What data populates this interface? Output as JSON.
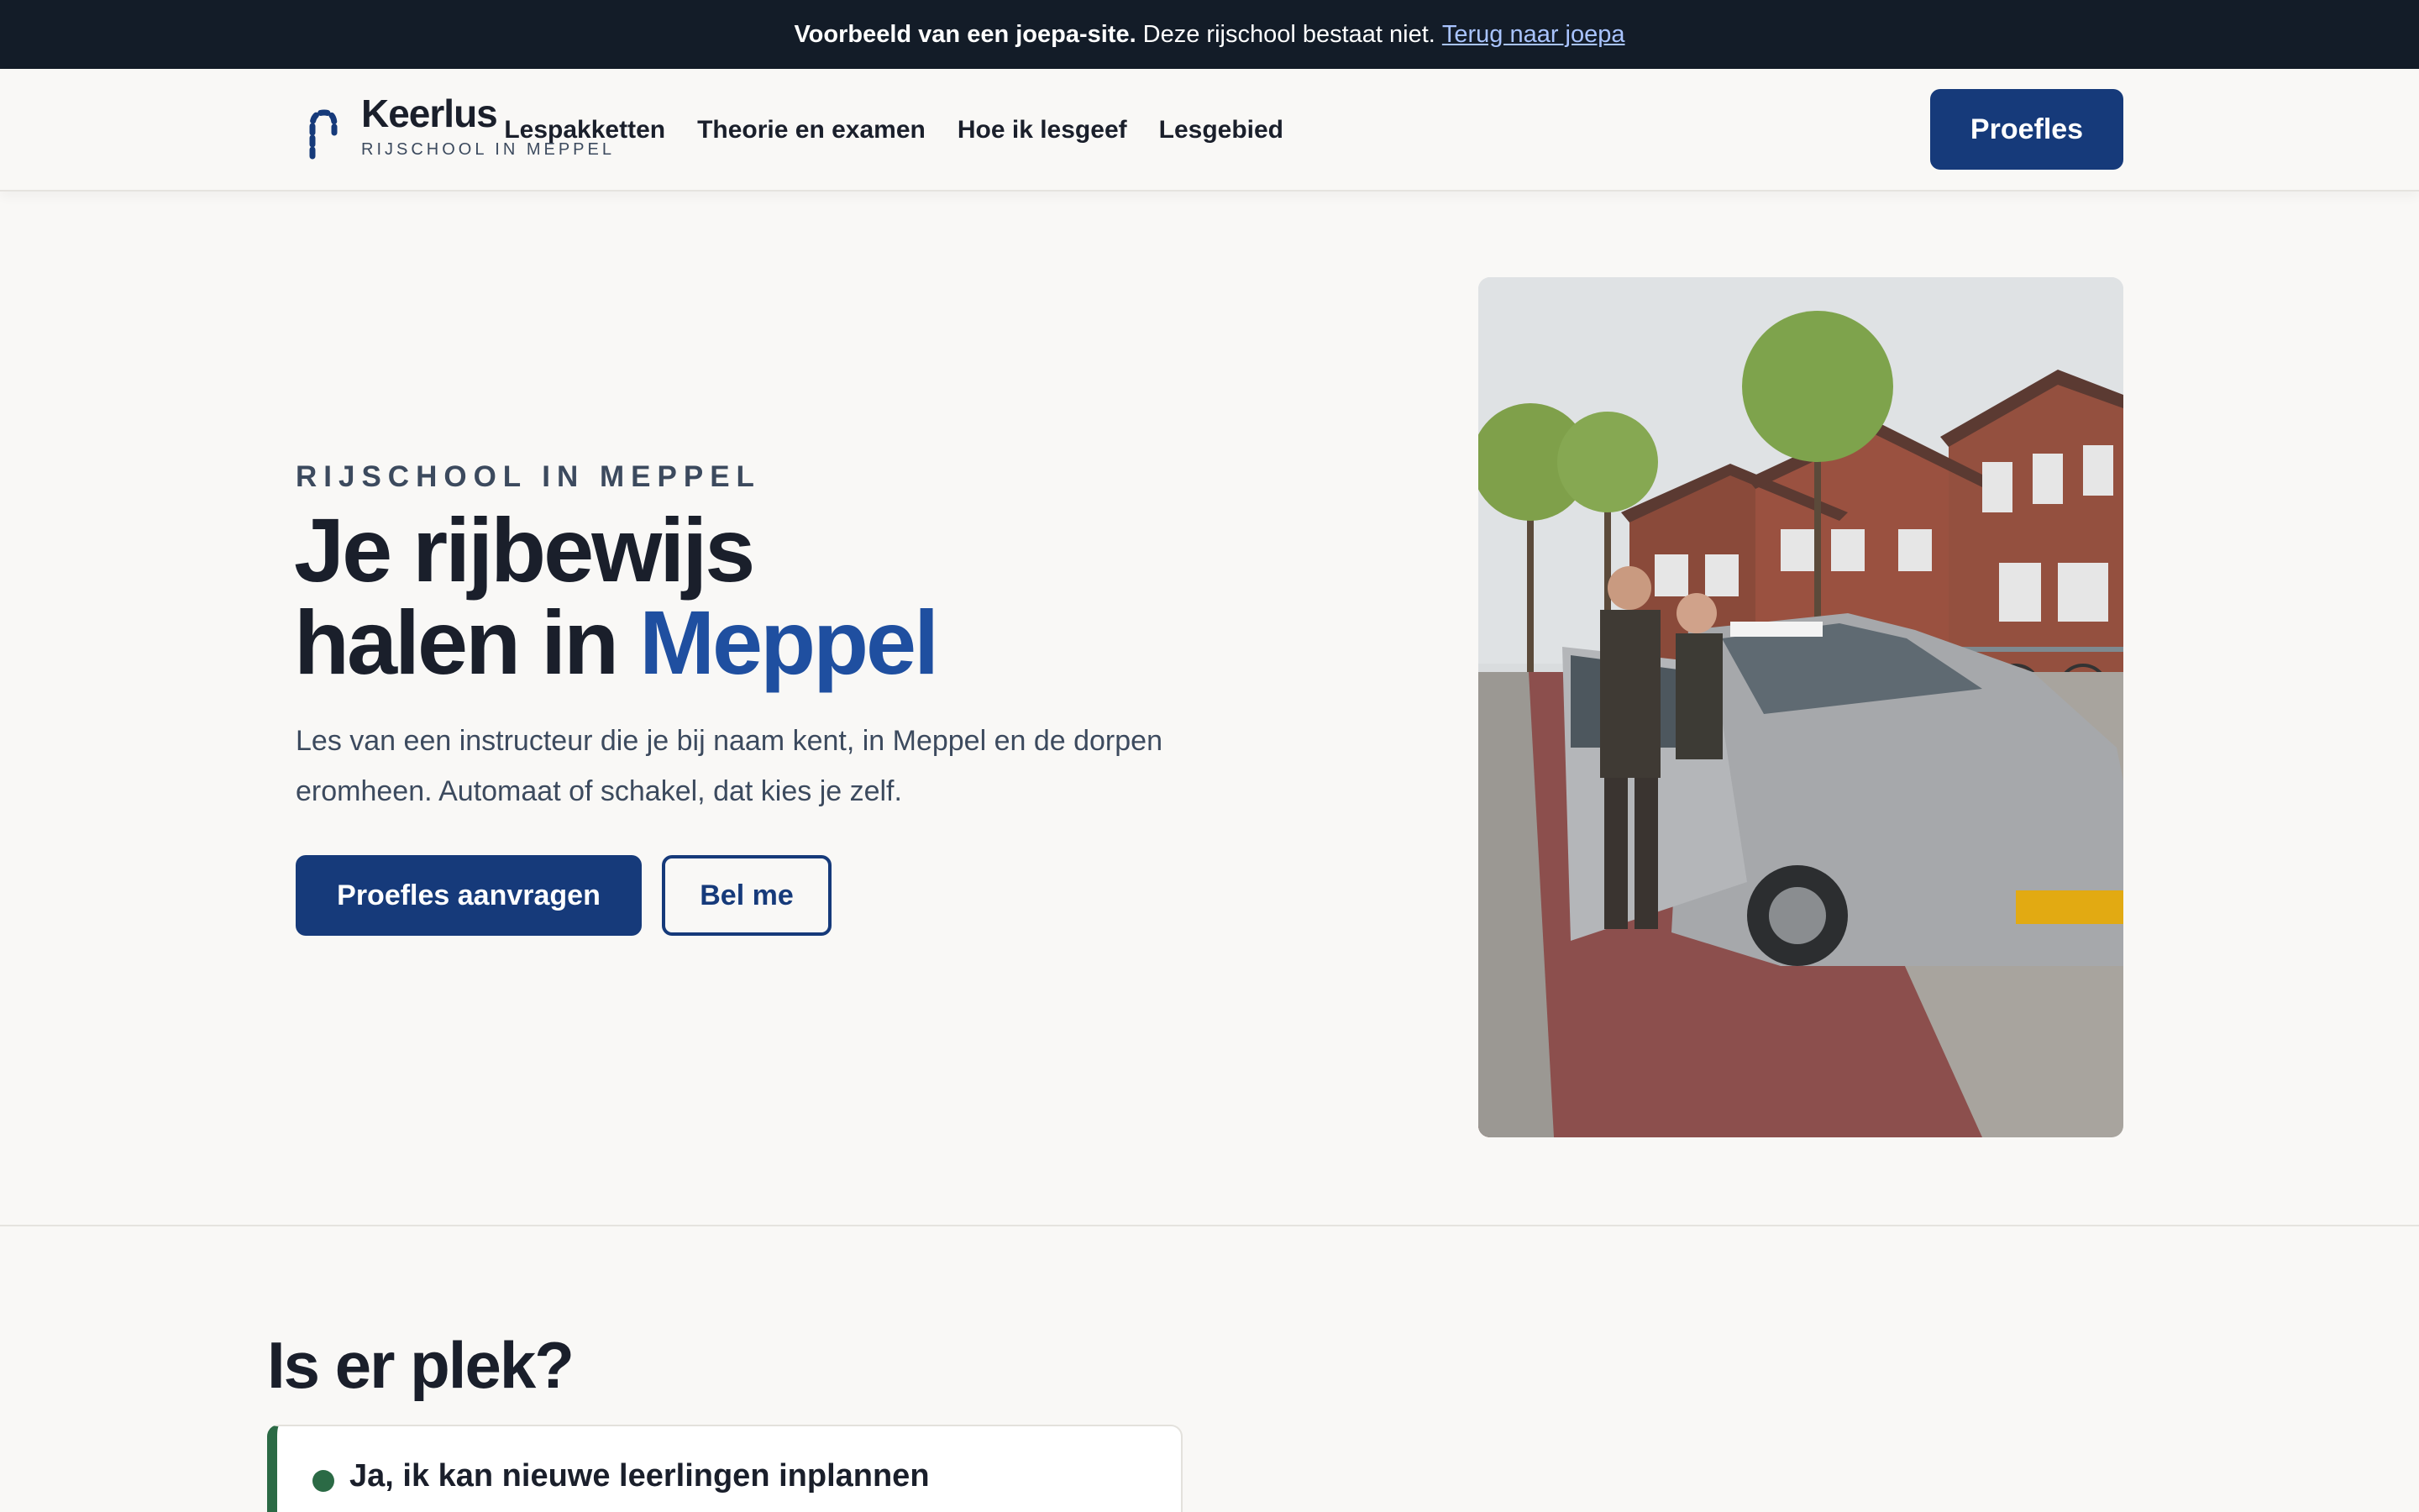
{
  "banner": {
    "bold": "Voorbeeld van een joepa-site.",
    "text": "Deze rijschool bestaat niet.",
    "link": "Terug naar joepa"
  },
  "header": {
    "logo_name": "Keerlus",
    "logo_sub": "RIJSCHOOL IN MEPPEL",
    "nav": [
      "Lespakketten",
      "Theorie en examen",
      "Hoe ik lesgeef",
      "Lesgebied"
    ],
    "cta": "Proefles"
  },
  "hero": {
    "eyebrow": "RIJSCHOOL IN MEPPEL",
    "title_line1": "Je rijbewijs",
    "title_line2_prefix": "halen in ",
    "title_accent": "Meppel",
    "description": "Les van een instructeur die je bij naam kent, in Meppel en de dorpen eromheen. Automaat of schakel, dat kies je zelf.",
    "primary_button": "Proefles aanvragen",
    "secondary_button": "Bel me"
  },
  "availability": {
    "title": "Is er plek?",
    "status": "Ja, ik kan nieuwe leerlingen inplannen"
  },
  "colors": {
    "brand": "#163a7a",
    "accent": "#1f4fa0",
    "status_green": "#2b6a45",
    "banner_bg": "#131c28"
  }
}
